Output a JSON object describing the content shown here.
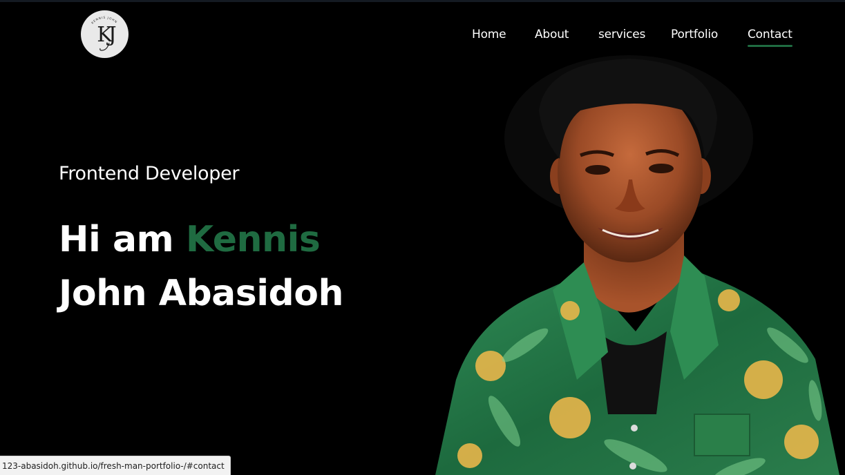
{
  "theme": {
    "background": "#000000",
    "text": "#ffffff",
    "accent": "#1f6b41"
  },
  "logo": {
    "icon": "kj-monogram-logo",
    "monogram": "KJ",
    "ring_text": "KENNIS JOHN"
  },
  "nav": {
    "items": [
      {
        "label": "Home"
      },
      {
        "label": "About"
      },
      {
        "label": "services"
      },
      {
        "label": "Portfolio"
      },
      {
        "label": "Contact",
        "active": true
      }
    ]
  },
  "hero": {
    "subtitle": "Frontend Developer",
    "greeting": "Hi am",
    "first_name": "Kennis",
    "last_names": "John Abasidoh",
    "portrait_icon": "profile-photo"
  },
  "status_bar": {
    "url": "123-abasidoh.github.io/fresh-man-portfolio-/#contact"
  }
}
